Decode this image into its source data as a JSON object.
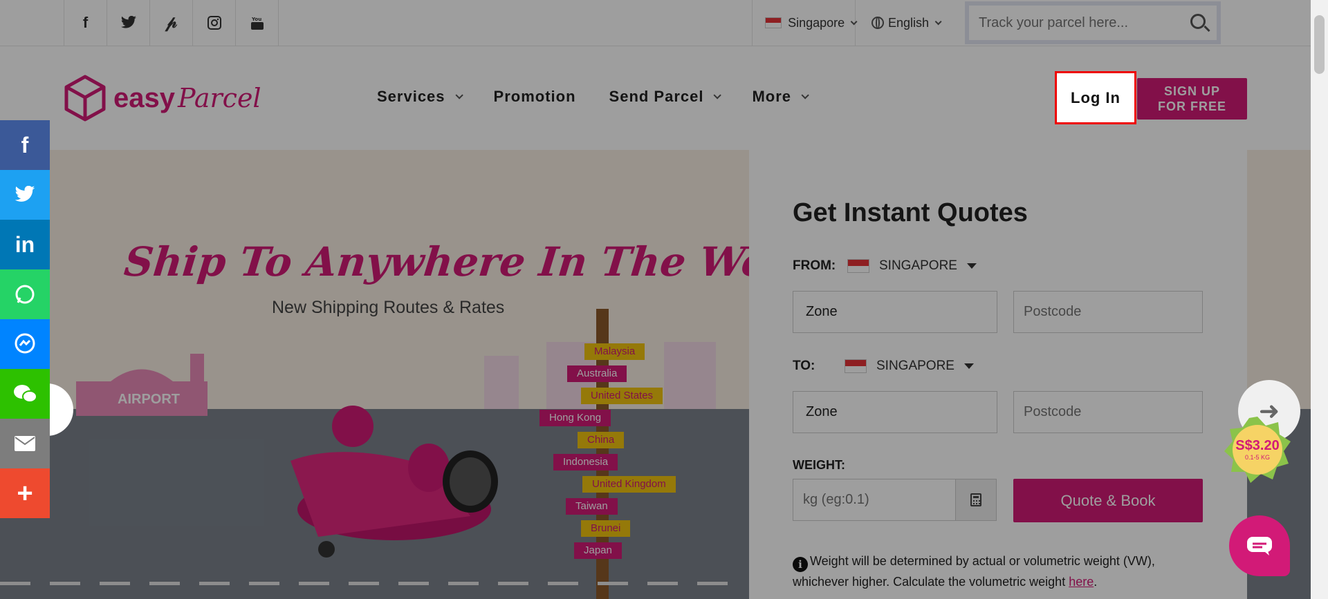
{
  "topbar": {
    "social_icons": [
      "facebook-icon",
      "twitter-icon",
      "pinterest-icon",
      "instagram-icon",
      "youtube-icon"
    ],
    "country": "Singapore",
    "language": "English",
    "track_placeholder": "Track your parcel here..."
  },
  "header": {
    "logo_easy": "easy",
    "logo_parcel": "Parcel",
    "nav": [
      {
        "label": "Services",
        "dropdown": true
      },
      {
        "label": "Promotion",
        "dropdown": false
      },
      {
        "label": "Send Parcel",
        "dropdown": true
      },
      {
        "label": "More",
        "dropdown": true
      }
    ],
    "login_label": "Log In",
    "signup_line1": "SIGN UP",
    "signup_line2": "FOR FREE"
  },
  "hero": {
    "title": "Ship To Anywhere In The World",
    "subtitle": "New Shipping Routes & Rates",
    "airport_label": "AIRPORT",
    "signs": [
      "Malaysia",
      "Australia",
      "United States",
      "Hong Kong",
      "China",
      "Indonesia",
      "United Kingdom",
      "Taiwan",
      "Brunei",
      "Japan"
    ]
  },
  "quote": {
    "title": "Get Instant Quotes",
    "from_label": "FROM:",
    "from_country": "SINGAPORE",
    "to_label": "TO:",
    "to_country": "SINGAPORE",
    "zone_value": "Zone",
    "postcode_placeholder": "Postcode",
    "weight_label": "WEIGHT:",
    "weight_placeholder": "kg (eg:0.1)",
    "quote_button": "Quote & Book",
    "note_text": "Weight will be determined by actual or volumetric weight (VW), whichever higher. Calculate the volumetric weight ",
    "note_link": "here",
    "note_end": "."
  },
  "side_social": [
    {
      "name": "facebook-icon",
      "glyph": "f",
      "color": "#3b5998"
    },
    {
      "name": "twitter-icon",
      "glyph": "t",
      "color": "#1da1f2"
    },
    {
      "name": "linkedin-icon",
      "glyph": "in",
      "color": "#0077b5"
    },
    {
      "name": "whatsapp-icon",
      "glyph": "✆",
      "color": "#25d366"
    },
    {
      "name": "messenger-icon",
      "glyph": "⚡",
      "color": "#0084ff"
    },
    {
      "name": "wechat-icon",
      "glyph": "●●",
      "color": "#2dc100"
    },
    {
      "name": "email-icon",
      "glyph": "✉",
      "color": "#7d7d7d"
    },
    {
      "name": "more-share-icon",
      "glyph": "+",
      "color": "#ee4a2f"
    }
  ],
  "promo": {
    "price": "S$3.20",
    "weight": "0.1-5 KG"
  },
  "colors": {
    "brand": "#d21a77",
    "highlight_border": "#e00000"
  }
}
